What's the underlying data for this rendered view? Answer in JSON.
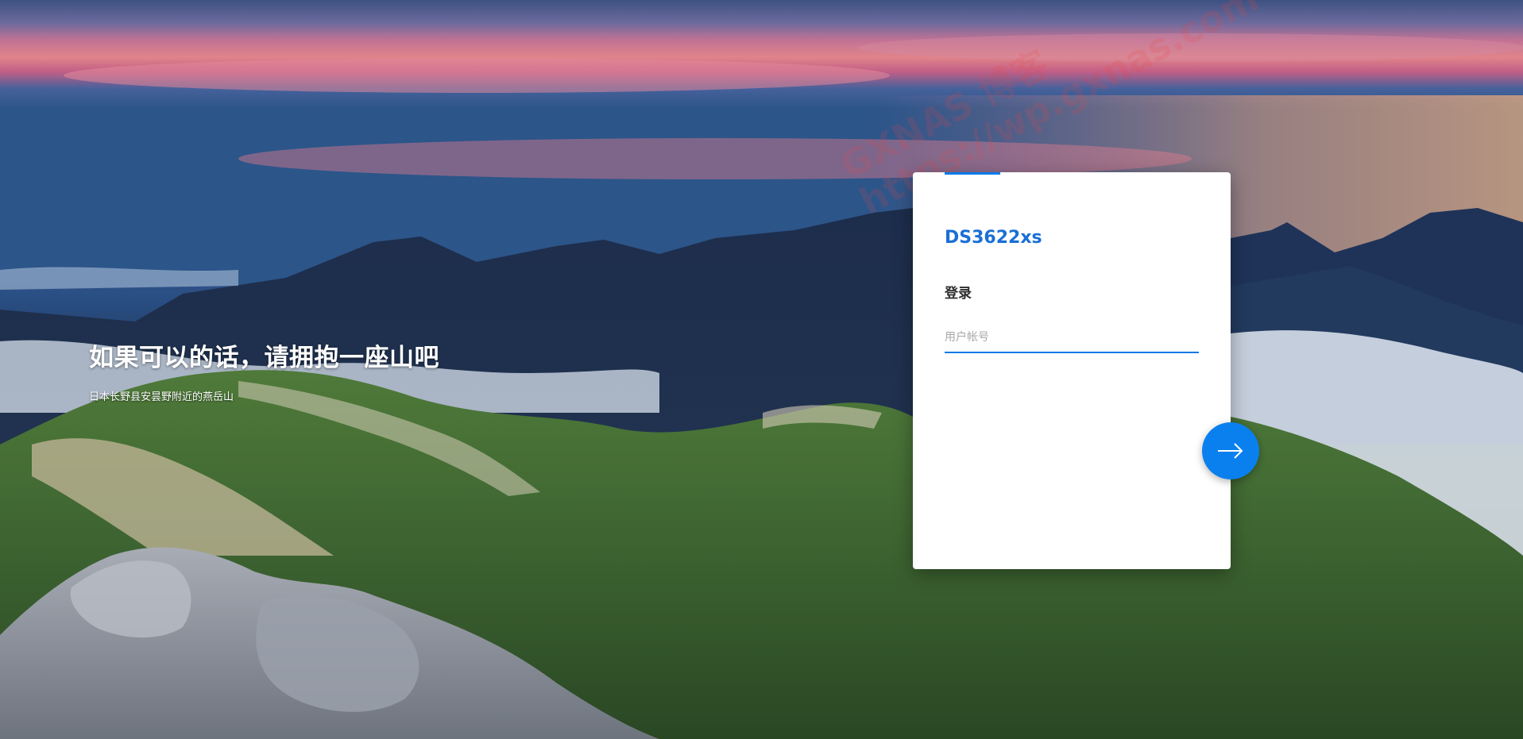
{
  "hero": {
    "title": "如果可以的话，请拥抱一座山吧",
    "caption": "日本长野县安昙野附近的燕岳山"
  },
  "login": {
    "device_name": "DS3622xs",
    "section_label": "登录",
    "username_placeholder": "用户帐号",
    "username_value": ""
  },
  "next_button": {
    "icon": "arrow-right-icon"
  },
  "watermark": {
    "line1": "GXNAS 博客",
    "line2": "https://wp.gxnas.com"
  },
  "colors": {
    "accent": "#0a7ae8",
    "title": "#1a6fd6",
    "button": "#0a80ee"
  }
}
